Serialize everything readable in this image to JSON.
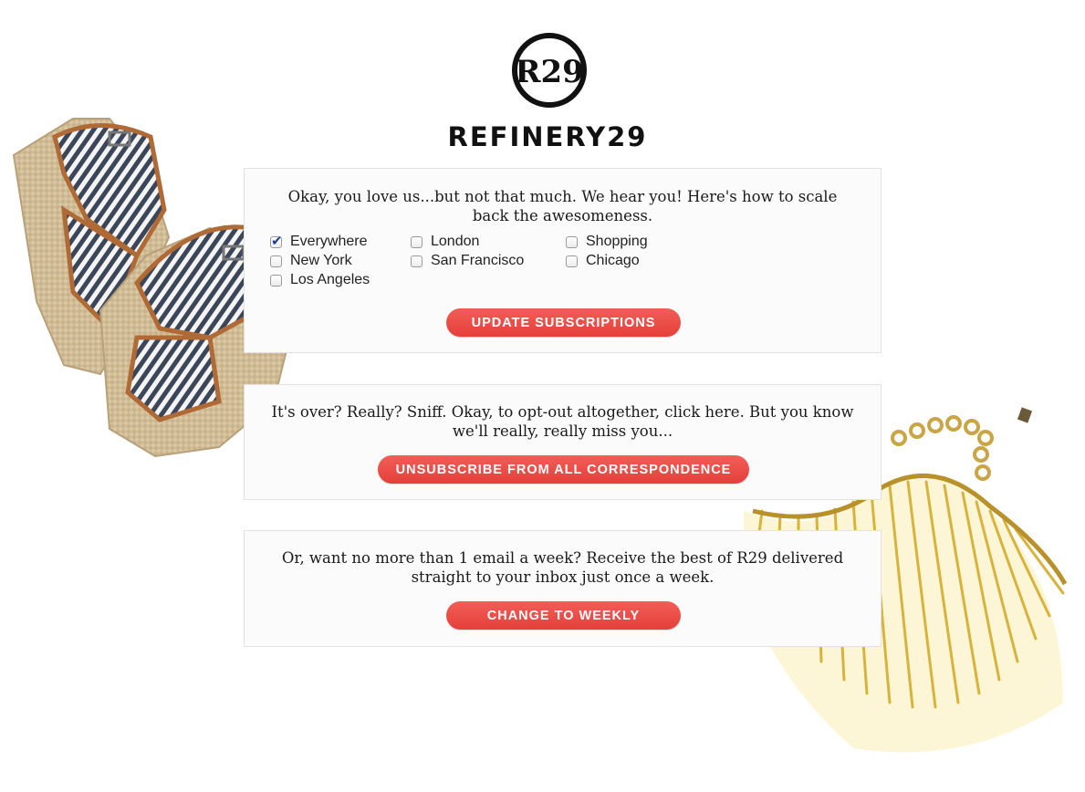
{
  "brand": {
    "logo_mark_text": "R29",
    "wordmark": "REFINERY29"
  },
  "subscriptions": {
    "intro": "Okay, you love us...but not that much. We hear you! Here's how to scale back the awesomeness.",
    "options": [
      {
        "label": "Everywhere",
        "checked": true
      },
      {
        "label": "New York",
        "checked": false
      },
      {
        "label": "Los Angeles",
        "checked": false
      },
      {
        "label": "London",
        "checked": false
      },
      {
        "label": "San Francisco",
        "checked": false
      },
      {
        "label": "Shopping",
        "checked": false
      },
      {
        "label": "Chicago",
        "checked": false
      }
    ],
    "button_label": "UPDATE SUBSCRIPTIONS"
  },
  "unsubscribe": {
    "text": "It's over? Really? Sniff. Okay, to opt-out altogether, click here. But you know we'll really, really miss you...",
    "button_label": "UNSUBSCRIBE FROM ALL CORRESPONDENCE"
  },
  "weekly": {
    "text": "Or, want no more than 1 email a week? Receive the best of R29 delivered straight to your inbox just once a week.",
    "button_label": "CHANGE TO WEEKLY"
  },
  "colors": {
    "button": "#ec4a45",
    "panel_bg": "#fbfbfb",
    "panel_border": "#e2e2e2"
  }
}
